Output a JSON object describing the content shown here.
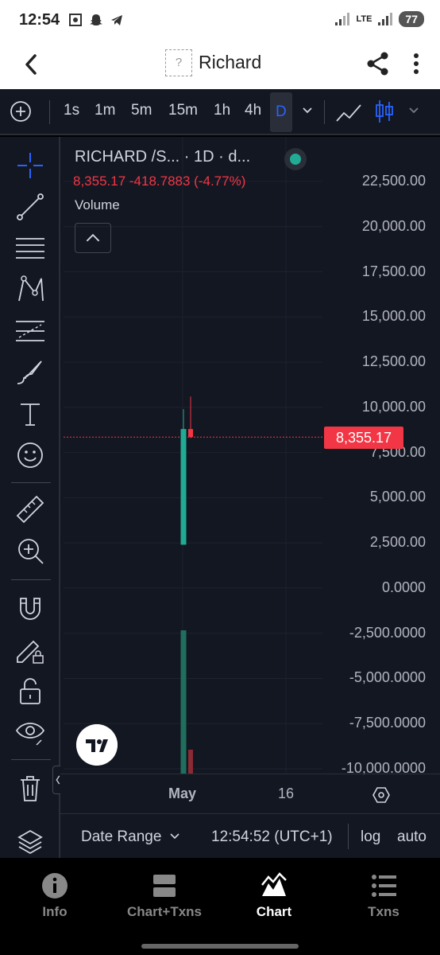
{
  "status_bar": {
    "time": "12:54",
    "network": "LTE",
    "battery": "77"
  },
  "header": {
    "title": "Richard",
    "token_placeholder": "?"
  },
  "toolbar": {
    "timeframes": [
      "1s",
      "1m",
      "5m",
      "15m",
      "1h",
      "4h",
      "D"
    ],
    "active_timeframe": "D"
  },
  "legend": {
    "symbol": "RICHARD /S... · 1D · d...",
    "values": "8,355.17  -418.7883 (-4.77%)",
    "volume_label": "Volume"
  },
  "price_axis": {
    "ticks": [
      "22,500.00",
      "20,000.00",
      "17,500.00",
      "15,000.00",
      "12,500.00",
      "10,000.00",
      "7,500.00",
      "5,000.00",
      "2,500.00",
      "0.0000",
      "-2,500.0000",
      "-5,000.0000",
      "-7,500.0000",
      "-10,000.0000"
    ],
    "last_price": "8,355.17"
  },
  "time_axis": {
    "labels": [
      "May",
      "16"
    ]
  },
  "range_bar": {
    "date_range": "Date Range",
    "clock": "12:54:52 (UTC+1)",
    "log": "log",
    "auto": "auto"
  },
  "nav": {
    "items": [
      {
        "label": "Info",
        "icon": "info-icon"
      },
      {
        "label": "Chart+Txns",
        "icon": "split-icon"
      },
      {
        "label": "Chart",
        "icon": "chart-icon"
      },
      {
        "label": "Txns",
        "icon": "list-icon"
      }
    ],
    "active": "Chart"
  },
  "colors": {
    "up": "#22ab94",
    "down": "#f23645",
    "background": "#131722",
    "accent": "#2962ff"
  },
  "chart_data": {
    "type": "candlestick",
    "series": [
      {
        "name": "RICHARD /S...",
        "candles": [
          {
            "open": 2400,
            "high": 9900,
            "low": 2400,
            "close": 8800,
            "direction": "up"
          },
          {
            "open": 8800,
            "high": 10600,
            "low": 8300,
            "close": 8355.17,
            "direction": "down"
          }
        ]
      }
    ],
    "volume": [
      {
        "direction": "up",
        "relative": 0.9
      },
      {
        "direction": "down",
        "relative": 0.15
      }
    ],
    "ylim": [
      -10000,
      22500
    ],
    "last_price": 8355.17
  }
}
